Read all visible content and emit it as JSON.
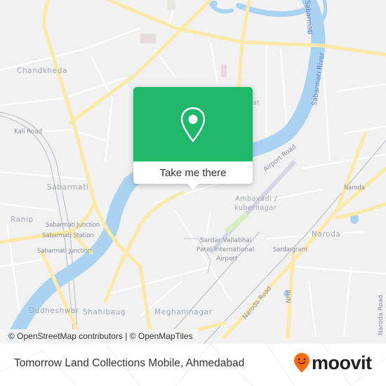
{
  "map": {
    "labels": {
      "chandkheda": "Chandkheda",
      "kali_road": "Kali Road",
      "sabarmati": "Sabarmati",
      "ranip": "Ranip",
      "sabarmati_junction_1": "Sabarmati Junction",
      "sabarmati_station": "Sabarmati Station",
      "sabarmati_junction_2": "Sabarmati Junction",
      "dudheshwar": "Dudheshwar",
      "shahibaug": "Shahibaug",
      "meghaninagar": "Meghaninagar",
      "airport_road": "Airport Road",
      "ambavadi": "Ambavadi /",
      "kubernagar": "kubernagar",
      "airport_1": "Sardar Vallabhai",
      "airport_2": "Patel International",
      "airport_3": "Airport",
      "sardargram": "Sardargram",
      "naroda_small": "Naroda",
      "naroda_big": "Naroda",
      "naroda_road": "Naroda Road",
      "nh8": "NH8",
      "naroda_road_edge": "Naroda Road",
      "sabarmati_river": "Sabarmati River",
      "sabarmati_top": "Sabarmati",
      "partial_at": "at"
    },
    "attribution": "© OpenStreetMap contributors | © OpenMapTiles",
    "colors": {
      "land": "#f1f1f2",
      "water": "#aad3f2",
      "major_road": "#fbe9a6",
      "minor_road": "#ffffff",
      "rail": "#b9bac2",
      "park": "#d6efc0"
    }
  },
  "popup": {
    "icon": "location-pin-icon",
    "button_label": "Take me there",
    "color": "#1fb86a"
  },
  "footer": {
    "place_title": "Tomorrow Land Collections Mobile, Ahmedabad",
    "brand": "moovit",
    "brand_color": "#ff6a13"
  }
}
